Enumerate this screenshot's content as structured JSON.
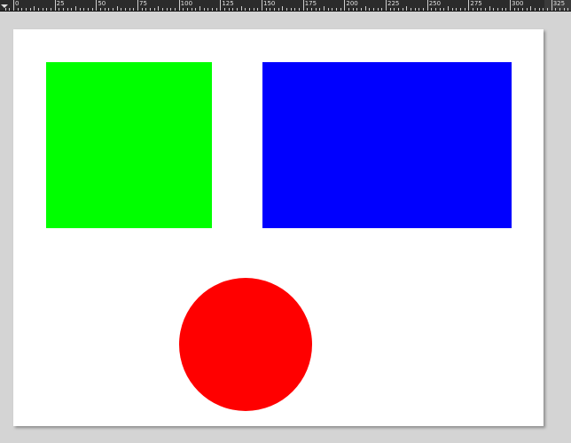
{
  "ruler": {
    "labels": [
      "0",
      "25",
      "50",
      "75",
      "100",
      "125",
      "150",
      "175",
      "200",
      "225",
      "250",
      "275",
      "300",
      "325"
    ]
  },
  "shapes": {
    "green_rect": {
      "color": "#00ff00"
    },
    "blue_rect": {
      "color": "#0000ff"
    },
    "red_circle": {
      "color": "#ff0000"
    }
  }
}
